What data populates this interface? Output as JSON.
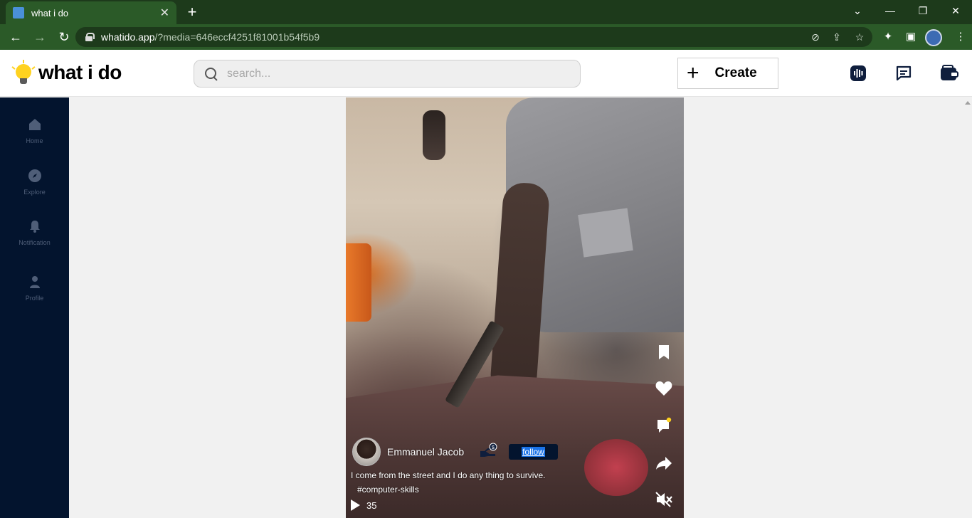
{
  "browser": {
    "tab_title": "what i do",
    "url_host": "whatido.app",
    "url_path": "/?media=646eccf4251f81001b54f5b9",
    "window_controls": [
      "minimize",
      "restore",
      "close"
    ]
  },
  "header": {
    "brand": "what i do",
    "search_placeholder": "search...",
    "create_label": "Create",
    "icons": [
      "podcast-icon",
      "messages-icon",
      "wallet-icon"
    ]
  },
  "sidebar": {
    "items": [
      {
        "label": "Home",
        "icon": "home-icon"
      },
      {
        "label": "Explore",
        "icon": "compass-icon"
      },
      {
        "label": "Notification",
        "icon": "bell-icon"
      },
      {
        "label": "Profile",
        "icon": "user-icon"
      }
    ]
  },
  "post": {
    "username": "Emmanuel Jacob",
    "follow_label": "follow",
    "caption": "I come from the street and I do any thing to survive.",
    "hashtag": "#computer-skills",
    "views": "35",
    "actions": [
      "bookmark-icon",
      "heart-icon",
      "comment-icon",
      "share-icon",
      "mute-icon"
    ]
  },
  "colors": {
    "sidebar_bg": "#03142e",
    "browser_frame": "#2b5a28",
    "accent_yellow": "#ffd21f"
  }
}
